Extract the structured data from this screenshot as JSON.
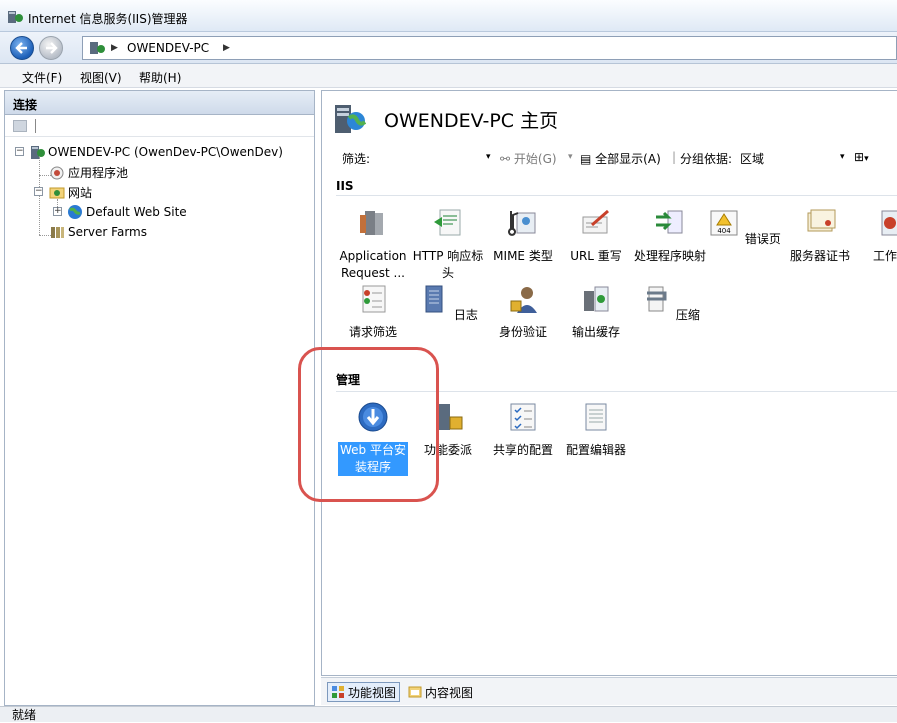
{
  "window": {
    "title": "Internet 信息服务(IIS)管理器"
  },
  "address": {
    "crumbs": [
      "OWENDEV-PC"
    ]
  },
  "menu": {
    "items": [
      "文件(F)",
      "视图(V)",
      "帮助(H)"
    ]
  },
  "connections": {
    "header": "连接",
    "tree": [
      {
        "label": "OWENDEV-PC (OwenDev-PC\\OwenDev)",
        "icon": "server-icon"
      },
      {
        "label": "应用程序池",
        "icon": "app-pool-icon"
      },
      {
        "label": "网站",
        "icon": "sites-folder-icon"
      },
      {
        "label": "Default Web Site",
        "icon": "globe-icon"
      },
      {
        "label": "Server Farms",
        "icon": "server-farm-icon"
      }
    ]
  },
  "main": {
    "title": "OWENDEV-PC 主页",
    "filter": {
      "label": "筛选:",
      "value": "",
      "go": "开始(G)",
      "show_all": "全部显示(A)",
      "group_by_label": "分组依据:",
      "group_by_value": "区域"
    },
    "groups": [
      {
        "name": "IIS",
        "features": [
          {
            "label": "Application Request ...",
            "icon": "application-request-routing-icon"
          },
          {
            "label": "HTTP 响应标头",
            "icon": "http-response-headers-icon"
          },
          {
            "label": "MIME 类型",
            "icon": "mime-types-icon"
          },
          {
            "label": "URL 重写",
            "icon": "url-rewrite-icon"
          },
          {
            "label": "处理程序映射",
            "icon": "handler-mappings-icon"
          },
          {
            "label": "错误页",
            "icon": "error-pages-icon"
          },
          {
            "label": "服务器证书",
            "icon": "server-certificates-icon"
          },
          {
            "label": "工作",
            "icon": "worker-processes-icon"
          },
          {
            "label": "请求筛选",
            "icon": "request-filtering-icon"
          },
          {
            "label": "日志",
            "icon": "logging-icon"
          },
          {
            "label": "身份验证",
            "icon": "authentication-icon"
          },
          {
            "label": "输出缓存",
            "icon": "output-caching-icon"
          },
          {
            "label": "压缩",
            "icon": "compression-icon"
          }
        ]
      },
      {
        "name": "管理",
        "features": [
          {
            "label": "Web 平台安装程序",
            "icon": "web-platform-installer-icon",
            "selected": true
          },
          {
            "label": "功能委派",
            "icon": "feature-delegation-icon"
          },
          {
            "label": "共享的配置",
            "icon": "shared-configuration-icon"
          },
          {
            "label": "配置编辑器",
            "icon": "configuration-editor-icon"
          }
        ]
      }
    ]
  },
  "view_tabs": {
    "features": "功能视图",
    "content": "内容视图"
  },
  "status": {
    "text": "就绪"
  },
  "colors": {
    "selection": "#3399ff",
    "highlight_ring": "#d9534f"
  }
}
